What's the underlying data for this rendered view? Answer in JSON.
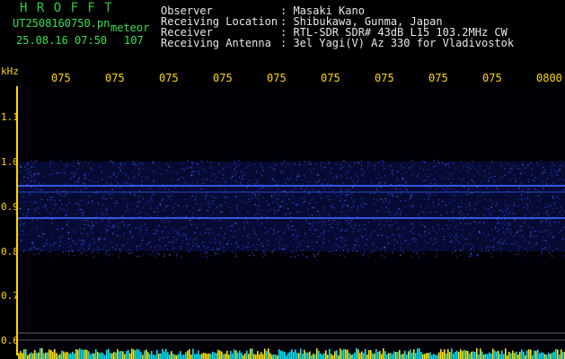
{
  "logo": "H R O F F T",
  "file": {
    "name": "UT2508160750.pn",
    "type_label": "meteor",
    "datetime": "25.08.16 07:50",
    "count": "107"
  },
  "info": {
    "labels": [
      "Observer",
      "Receiving Location",
      "Receiver",
      "Receiving Antenna"
    ],
    "values": [
      ": Masaki Kano",
      ": Shibukawa, Gunma, Japan",
      ": RTL-SDR SDR# 43dB L15 103.2MHz CW",
      ": 3el Yagi(V) Az 330 for Vladivostok"
    ]
  },
  "axis": {
    "unit": "kHz",
    "y_ticks": [
      "1.1",
      "1.0",
      "0.9",
      "0.8",
      "0.7",
      "0.6"
    ],
    "x_ticks": [
      "075",
      "075",
      "075",
      "075",
      "075",
      "075",
      "075",
      "075",
      "075",
      "0800"
    ]
  },
  "colors": {
    "signal": "#2a4cff",
    "band": "#13208a",
    "noise_bar": "#00e5ff",
    "noise_peak": "#ffe600",
    "axis": "#ffd700"
  }
}
